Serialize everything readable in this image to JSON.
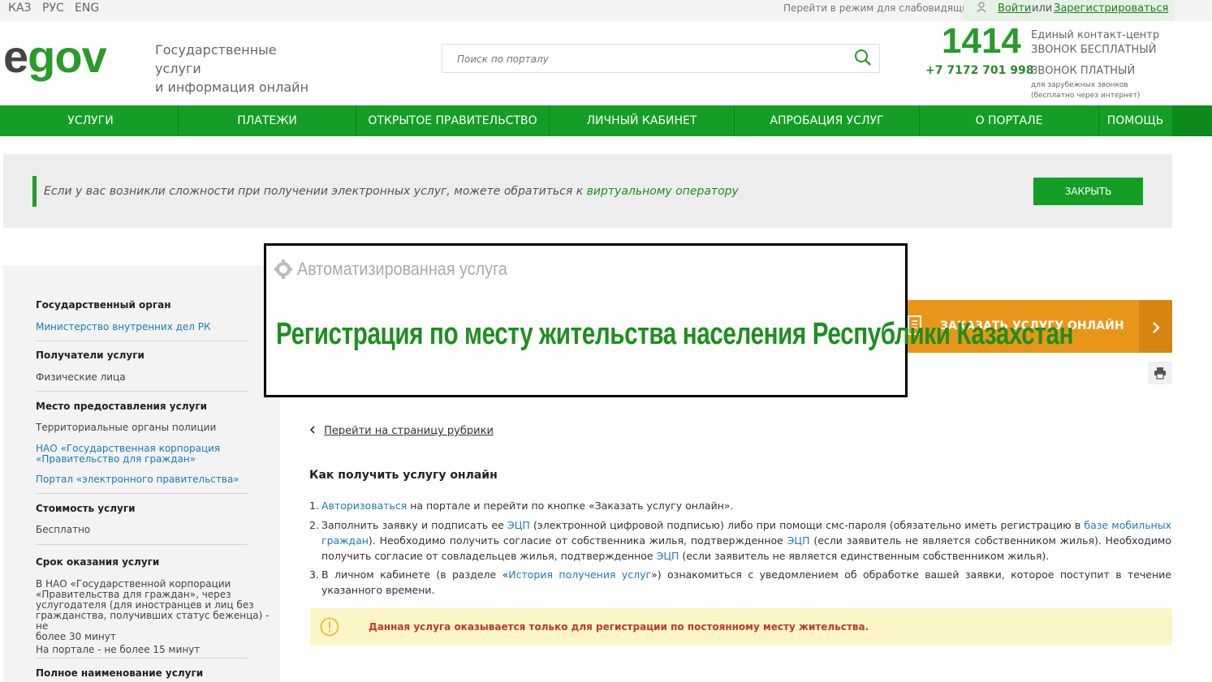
{
  "topbar": {
    "languages": [
      "КАЗ",
      "РУС",
      "ENG"
    ],
    "vision_mode": "Перейти в режим для слабовидящих",
    "login": "Войти",
    "or": "или",
    "register": "Зарегистрироваться"
  },
  "header": {
    "logo_e": "e",
    "logo_gov": "gov",
    "tagline_line1": "Государственные услуги",
    "tagline_line2": "и информация онлайн",
    "search_placeholder": "Поиск по порталу",
    "phone_short": "1414",
    "contact_line1": "Единый контакт-центр",
    "contact_line2": "ЗВОНОК БЕСПЛАТНЫЙ",
    "phone_long": "+7 7172 701 998",
    "contact_paid": "ЗВОНОК ПЛАТНЫЙ",
    "contact_foreign1": "для зарубежных звонков",
    "contact_foreign2": "(бесплатно через интернет)"
  },
  "nav": [
    "УСЛУГИ",
    "ПЛАТЕЖИ",
    "ОТКРЫТОЕ ПРАВИТЕЛЬСТВО",
    "ЛИЧНЫЙ КАБИНЕТ",
    "АПРОБАЦИЯ УСЛУГ",
    "О ПОРТАЛЕ",
    "ПОМОЩЬ"
  ],
  "notice": {
    "text": "Если у вас возникли сложности при получении электронных услуг, можете обратиться к ",
    "link": "виртуальному оператору",
    "close": "ЗАКРЫТЬ"
  },
  "service": {
    "auto_label": "Автоматизированная услуга",
    "title": "Регистрация по месту жительства населения Республики Казахстан",
    "order_button": "ЗАКАЗАТЬ УСЛУГУ ОНЛАЙН"
  },
  "sidebar": {
    "gov_body_title": "Государственный орган",
    "gov_body": "Министерство внутренних дел РК",
    "recipients_title": "Получатели услуги",
    "recipients": "Физические лица",
    "place_title": "Место предоставления услуги",
    "place1": "Территориальные органы полиции",
    "place2_line1": "НАО «Государственная корпорация",
    "place2_line2": "«Правительство для граждан»",
    "place3": "Портал «электронного правительства»",
    "cost_title": "Стоимость услуги",
    "cost": "Бесплатно",
    "term_title": "Срок оказания услуги",
    "term_line1": "В НАО «Государственной корпорации",
    "term_line2": "«Правительства для граждан», через",
    "term_line3": "услугодателя (для иностранцев и лиц без",
    "term_line4": "гражданства, получивших статус беженца) - не",
    "term_line5": "более 30 минут",
    "term_line6": "На портале - не более 15 минут",
    "fullname_title": "Полное наименование услуги"
  },
  "main": {
    "back_link": "Перейти на страницу рубрики",
    "how_title": "Как получить услугу онлайн",
    "step1_num": "1.",
    "step1_link": "Авторизоваться",
    "step1_text": " на портале и перейти по кнопке «Заказать услугу онлайн».",
    "step2_num": "2.",
    "step2_a": "Заполнить заявку и подписать ее ",
    "step2_ecp1": "ЭЦП",
    "step2_b": " (электронной цифровой подписью) либо при помощи смс-пароля (обязательно иметь регистрацию в ",
    "step2_base": "базе мобильных граждан",
    "step2_c": "). Необходимо получить согласие от собственника жилья, подтвержденное ",
    "step2_ecp2": "ЭЦП",
    "step2_d": " (если заявитель не является собственником жилья). Необходимо получить согласие от совладельцев жилья, подтвержденное ",
    "step2_ecp3": "ЭЦП",
    "step2_e": " (если заявитель не является единственным собственником жилья).",
    "step3_num": "3.",
    "step3_a": "В личном кабинете (в разделе «",
    "step3_link": "История получения услуг",
    "step3_b": "») ознакомиться с уведомлением об обработке вашей заявки, которое поступит в течение указанного времени.",
    "warning": "Данная услуга оказывается только для регистрации по постоянному месту жительства."
  },
  "colors": {
    "brand_green": "#159e25",
    "order_orange": "#e8961a",
    "link_blue": "#1a7ac2",
    "warning_bg": "#fbf5c8",
    "warning_text": "#c0392b"
  },
  "icons": [
    "user-icon",
    "search-icon",
    "gear-icon",
    "document-icon",
    "chevron-right-icon",
    "printer-icon",
    "chevron-left-icon",
    "info-icon"
  ]
}
